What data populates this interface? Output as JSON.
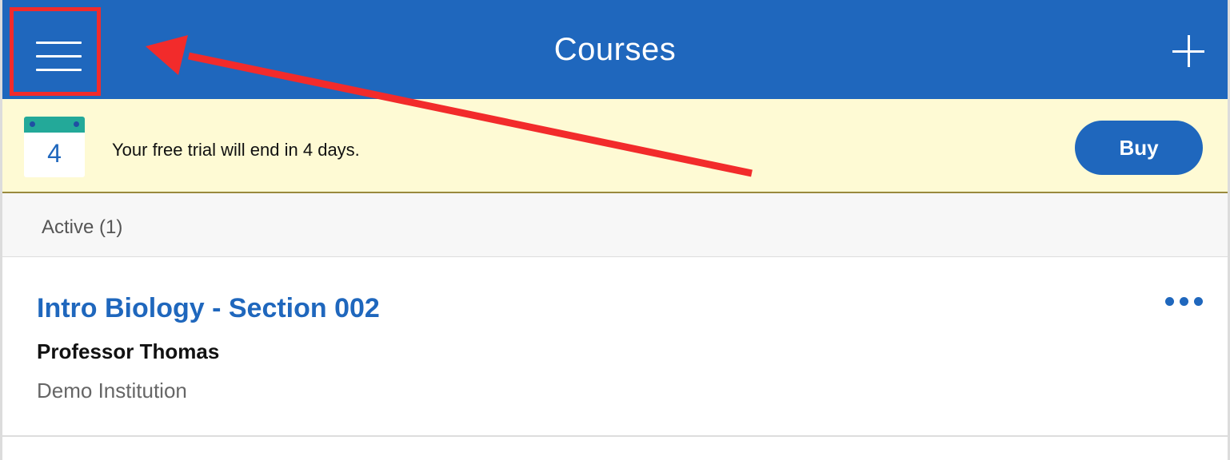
{
  "header": {
    "title": "Courses",
    "menu_icon": "hamburger-menu-icon",
    "add_icon": "plus-icon",
    "color": "#1f67bd"
  },
  "trial_banner": {
    "calendar_day": "4",
    "message": "Your free trial will end in 4 days.",
    "buy_label": "Buy",
    "background": "#fefad4"
  },
  "section": {
    "label": "Active (1)"
  },
  "courses": [
    {
      "title": "Intro Biology - Section 002",
      "professor": "Professor Thomas",
      "institution": "Demo Institution"
    }
  ],
  "annotation": {
    "highlight_color": "#f22b2b",
    "arrow_icon": "arrow-annotation-icon"
  }
}
